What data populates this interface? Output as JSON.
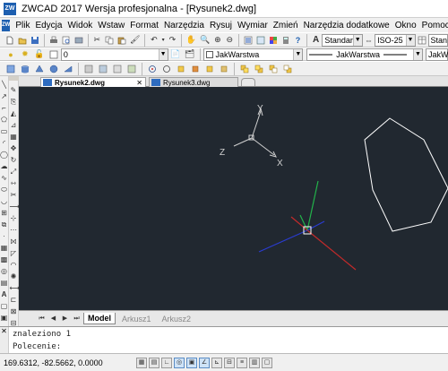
{
  "window": {
    "title": "ZWCAD 2017 Wersja profesjonalna - [Rysunek2.dwg]",
    "app_icon_text": "ZW"
  },
  "menu": {
    "zw_icon_text": "ZW",
    "items": [
      "Plik",
      "Edycja",
      "Widok",
      "Wstaw",
      "Format",
      "Narzędzia",
      "Rysuj",
      "Wymiar",
      "Zmień",
      "Narzędzia dodatkowe",
      "Okno",
      "Pomoc"
    ]
  },
  "toolbar1": {
    "text_style_value": "Standard",
    "dim_style_value": "ISO-25",
    "table_style_value": "Stan"
  },
  "toolbar2": {
    "layer_value": "0",
    "color_value": "JakWarstwa",
    "linetype_value": "JakWarstwa",
    "lineweight_value": "JakW"
  },
  "tabs": {
    "documents": [
      {
        "label": "Rysunek2.dwg",
        "close": "✕",
        "active": true
      },
      {
        "label": "Rysunek3.dwg",
        "active": false
      }
    ]
  },
  "ucs": {
    "x_label": "X",
    "y_label": "Y",
    "z_label": "Z"
  },
  "colors": {
    "canvas_bg": "#212830",
    "polygon_stroke": "#ffffff",
    "axis_x": "#c42a2a",
    "axis_y": "#22b24a",
    "axis_z": "#2a3cd0"
  },
  "layout_tabs": {
    "items": [
      {
        "label": "Model",
        "active": true
      },
      {
        "label": "Arkusz1",
        "active": false
      },
      {
        "label": "Arkusz2",
        "active": false
      }
    ]
  },
  "command": {
    "history": "znaleziono 1",
    "prompt": "Polecenie:"
  },
  "status": {
    "coordinates": "169.6312, -82.5662, 0.0000"
  }
}
